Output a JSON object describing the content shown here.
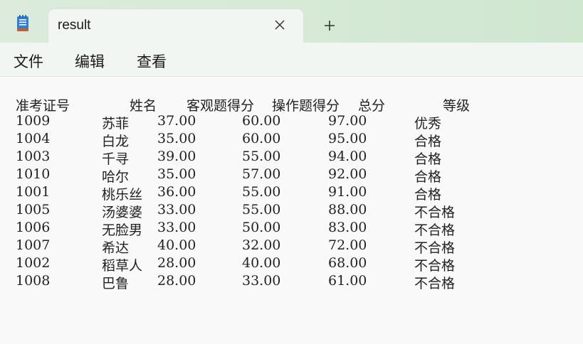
{
  "window": {
    "tab_title": "result",
    "new_tab_symbol": "+",
    "app_icon": "notepad-icon",
    "close_icon": "close-icon"
  },
  "menu": {
    "file": "文件",
    "edit": "编辑",
    "view": "查看"
  },
  "content": {
    "headers": [
      "准考证号",
      "姓名",
      "客观题得分",
      "操作题得分",
      "总分",
      "等级"
    ],
    "rows": [
      [
        "1009",
        "苏菲",
        "37.00",
        "60.00",
        "97.00",
        "优秀"
      ],
      [
        "1004",
        "白龙",
        "35.00",
        "60.00",
        "95.00",
        "合格"
      ],
      [
        "1003",
        "千寻",
        "39.00",
        "55.00",
        "94.00",
        "合格"
      ],
      [
        "1010",
        "哈尔",
        "35.00",
        "57.00",
        "92.00",
        "合格"
      ],
      [
        "1001",
        "桃乐丝",
        "36.00",
        "55.00",
        "91.00",
        "合格"
      ],
      [
        "1005",
        "汤婆婆",
        "33.00",
        "55.00",
        "88.00",
        "不合格"
      ],
      [
        "1006",
        "无脸男",
        "33.00",
        "50.00",
        "83.00",
        "不合格"
      ],
      [
        "1007",
        "希达",
        "40.00",
        "32.00",
        "72.00",
        "不合格"
      ],
      [
        "1002",
        "稻草人",
        "28.00",
        "40.00",
        "68.00",
        "不合格"
      ],
      [
        "1008",
        "巴鲁",
        "28.00",
        "33.00",
        "61.00",
        "不合格"
      ]
    ]
  },
  "colors": {
    "titlebar": "#d6ead6",
    "tab": "#f2f6f2",
    "text_area": "#f9f9f9"
  }
}
